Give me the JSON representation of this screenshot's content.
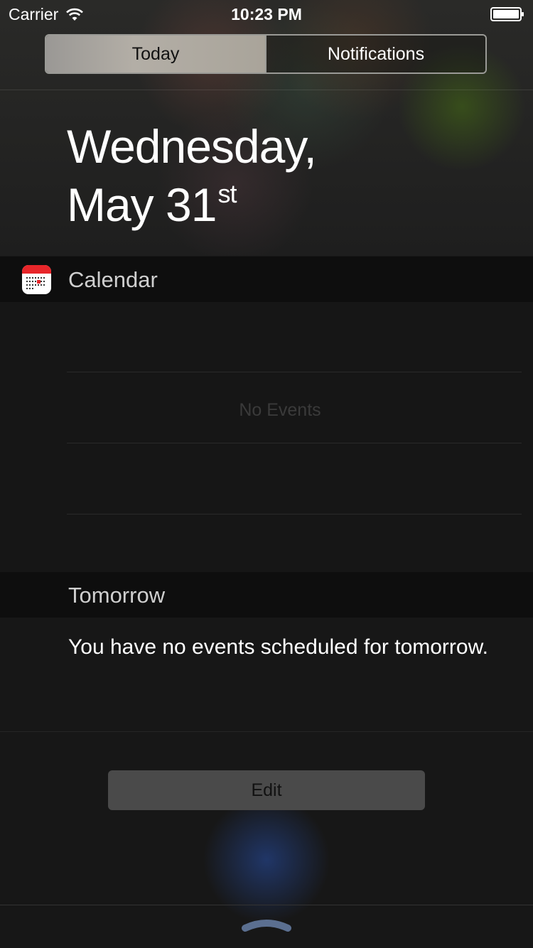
{
  "status_bar": {
    "carrier": "Carrier",
    "time": "10:23 PM",
    "wifi_icon": "wifi-icon",
    "battery_icon": "battery-icon"
  },
  "segmented_control": {
    "today_label": "Today",
    "notifications_label": "Notifications",
    "selected": "Today"
  },
  "date_header": {
    "line1": "Wednesday,",
    "line2_main": "May 31",
    "line2_suffix": "st"
  },
  "calendar_section": {
    "title": "Calendar",
    "icon": "calendar-app-icon",
    "empty_text": "No Events"
  },
  "tomorrow_section": {
    "title": "Tomorrow",
    "message": "You have no events scheduled for tomorrow."
  },
  "edit_button": {
    "label": "Edit"
  },
  "grabber": {
    "icon": "grabber-chevron-icon"
  },
  "colors": {
    "accent_red": "#e8262a",
    "segment_selected": "#aca79f",
    "background": "#171717"
  }
}
